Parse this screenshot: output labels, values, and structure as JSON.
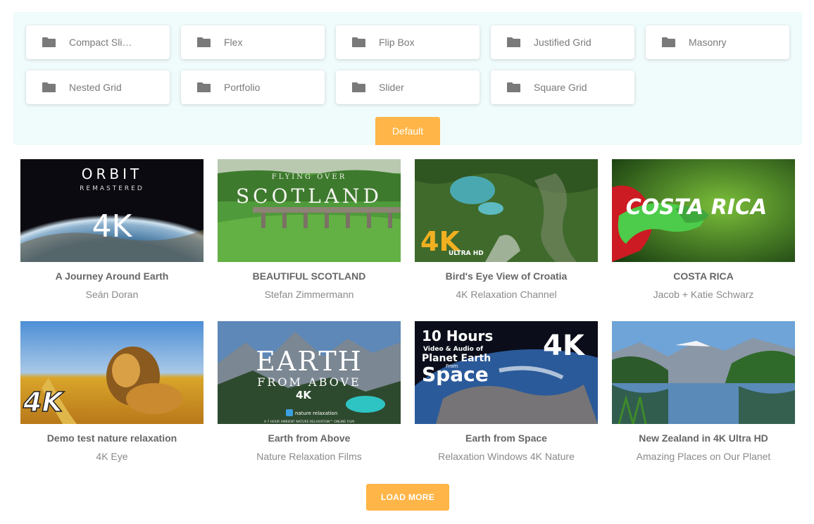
{
  "categories": [
    {
      "label": "Compact Sli…",
      "icon": "folder-icon"
    },
    {
      "label": "Flex",
      "icon": "folder-icon"
    },
    {
      "label": "Flip Box",
      "icon": "folder-icon"
    },
    {
      "label": "Justified Grid",
      "icon": "folder-icon"
    },
    {
      "label": "Masonry",
      "icon": "folder-icon"
    },
    {
      "label": "Nested Grid",
      "icon": "folder-icon"
    },
    {
      "label": "Portfolio",
      "icon": "folder-icon"
    },
    {
      "label": "Slider",
      "icon": "folder-icon"
    },
    {
      "label": "Square Grid",
      "icon": "folder-icon"
    }
  ],
  "default_button": "Default",
  "videos": [
    {
      "title": "A Journey Around Earth",
      "author": "Seán Doran",
      "thumb_text": [
        "ORBIT",
        "REMASTERED",
        "4K"
      ]
    },
    {
      "title": "BEAUTIFUL SCOTLAND",
      "author": "Stefan Zimmermann",
      "thumb_text": [
        "FLYING OVER",
        "SCOTLAND"
      ]
    },
    {
      "title": "Bird's Eye View of Croatia",
      "author": "4K Relaxation Channel",
      "thumb_text": [
        "4K",
        "ULTRA HD"
      ]
    },
    {
      "title": "COSTA RICA",
      "author": "Jacob + Katie Schwarz",
      "thumb_text": [
        "COSTA RICA"
      ]
    },
    {
      "title": "Demo test nature relaxation",
      "author": "4K Eye",
      "thumb_text": [
        "4K"
      ]
    },
    {
      "title": "Earth from Above",
      "author": "Nature Relaxation Films",
      "thumb_text": [
        "EARTH",
        "FROM ABOVE",
        "4K",
        "nature relaxation",
        "A 7 HOUR AMBIENT NATURE RELAXATION™ ONLINE FILM"
      ]
    },
    {
      "title": "Earth from Space",
      "author": "Relaxation Windows 4K Nature",
      "thumb_text": [
        "10 Hours",
        "Video & Audio of",
        "Planet Earth",
        "From",
        "Space",
        "4K"
      ]
    },
    {
      "title": "New Zealand in 4K Ultra HD",
      "author": "Amazing Places on Our Planet",
      "thumb_text": []
    }
  ],
  "load_more": "LOAD MORE",
  "colors": {
    "accent": "#ffb547",
    "panel_bg": "#f0fbfb",
    "folder_icon": "#7a7a7a"
  }
}
